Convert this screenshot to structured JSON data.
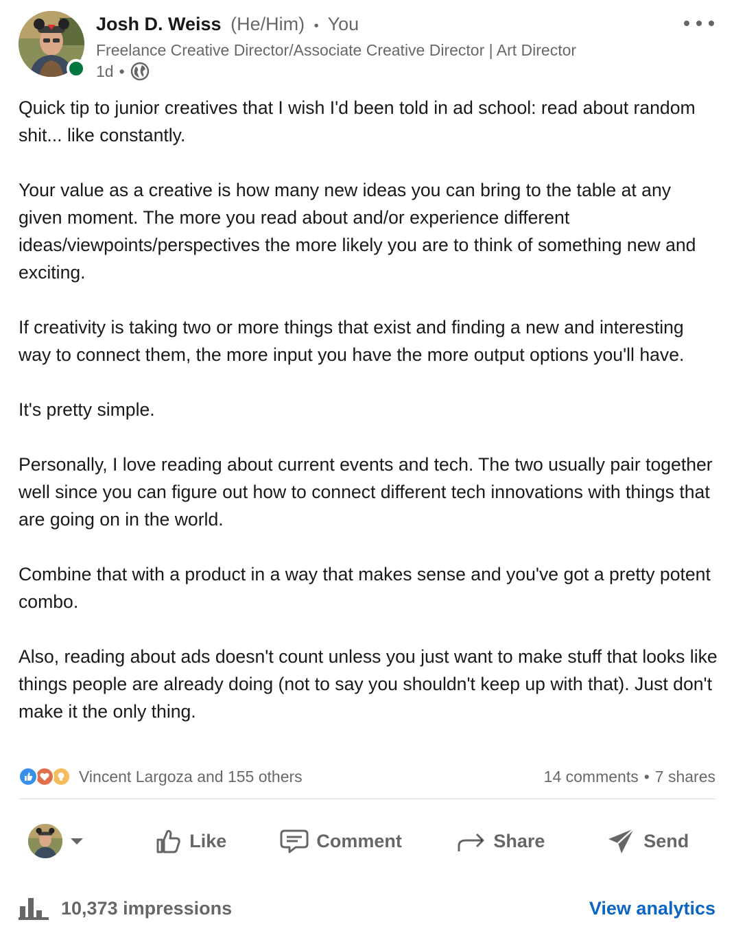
{
  "author": {
    "name": "Josh D. Weiss",
    "pronouns": "(He/Him)",
    "relation": "You",
    "headline": "Freelance Creative Director/Associate Creative Director | Art Director",
    "time": "1d",
    "separator": "•",
    "visibility_icon": "globe-icon",
    "presence_color": "#057642"
  },
  "post": {
    "paragraphs": [
      "Quick tip to junior creatives that I wish I'd been told in ad school: read about random shit... like constantly.",
      "Your value as a creative is how many new ideas you can bring to the table at any given moment. The more you read about and/or experience different ideas/viewpoints/perspectives the more likely you are to think of something new and exciting.",
      "If creativity is taking two or more things that exist and finding a new and interesting way to connect them, the more input you have the more output options you'll have.",
      "It's pretty simple.",
      "Personally, I love reading about current events and tech. The two usually pair together well since you can figure out how to connect different tech innovations with things that are going on in the world.",
      "Combine that with a product in a way that makes sense and you've got a pretty potent combo.",
      "Also, reading about ads doesn't count unless you just want to make stuff that looks like things people are already doing (not to say you shouldn't keep up with that). Just don't make it the only thing."
    ]
  },
  "social": {
    "reactions_text": "Vincent Largoza and 155 others",
    "reaction_icons": [
      "like-icon",
      "love-icon",
      "insightful-icon"
    ],
    "comments": "14 comments",
    "separator": "•",
    "shares": "7 shares"
  },
  "actions": {
    "like": "Like",
    "comment": "Comment",
    "share": "Share",
    "send": "Send"
  },
  "footer": {
    "impressions": "10,373 impressions",
    "view_analytics": "View analytics",
    "link_color": "#0a66c2"
  }
}
